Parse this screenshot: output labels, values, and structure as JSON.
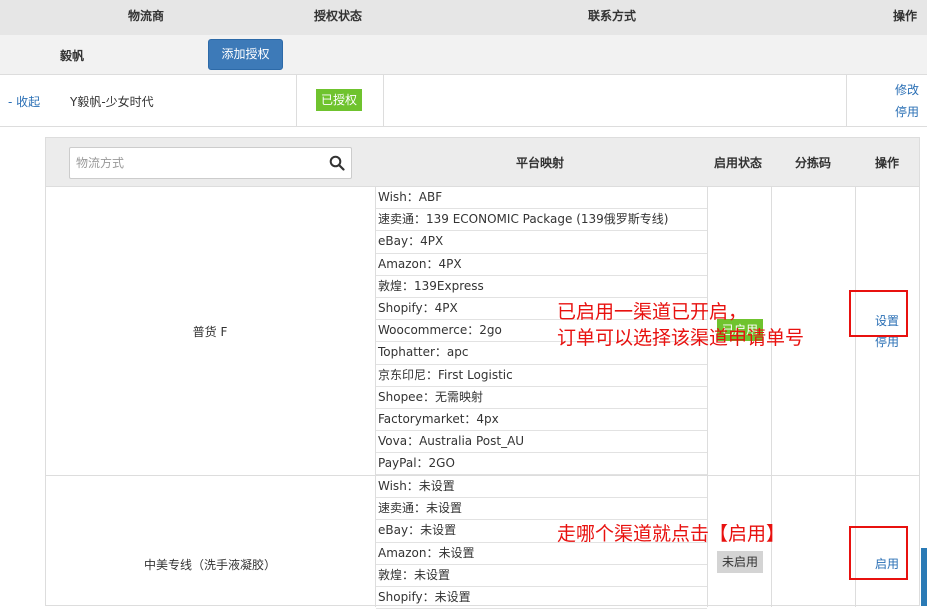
{
  "top_header": {
    "col_carrier": "物流商",
    "col_auth_status": "授权状态",
    "col_contact": "联系方式",
    "col_ops": "操作"
  },
  "provider": {
    "name": "毅帆",
    "add_auth_label": "添加授权"
  },
  "account": {
    "collapse_label": "- 收起",
    "name": "Y毅帆-少女时代",
    "auth_status": "已授权",
    "edit_label": "修改",
    "disable_label": "停用"
  },
  "sub_table": {
    "search_placeholder": "物流方式",
    "col_mapping": "平台映射",
    "col_status": "启用状态",
    "col_sort_code": "分拣码",
    "col_ops": "操作"
  },
  "methods": [
    {
      "name": "普货 F",
      "status": "已启用",
      "op1": "设置",
      "op2": "停用",
      "mappings": [
        "Wish：ABF",
        "速卖通：139 ECONOMIC Package (139俄罗斯专线)",
        "eBay：4PX",
        "Amazon：4PX",
        "敦煌：139Express",
        "Shopify：4PX",
        "Woocommerce：2go",
        "Tophatter：apc",
        "京东印尼：First Logistic",
        "Shopee：无需映射",
        "Factorymarket：4px",
        "Vova：Australia Post_AU",
        "PayPal：2GO"
      ]
    },
    {
      "name": "中美专线（洗手液凝胶）",
      "status": "未启用",
      "op1": "启用",
      "mappings": [
        "Wish：未设置",
        "速卖通：未设置",
        "eBay：未设置",
        "Amazon：未设置",
        "敦煌：未设置",
        "Shopify：未设置"
      ]
    }
  ],
  "annotations": {
    "note1_line1": "已启用一渠道已开启，",
    "note1_line2": "订单可以选择该渠道申请单号",
    "note2": "走哪个渠道就点击【启用】",
    "color": "#e8110f"
  },
  "icons": {
    "search": "search-icon"
  }
}
